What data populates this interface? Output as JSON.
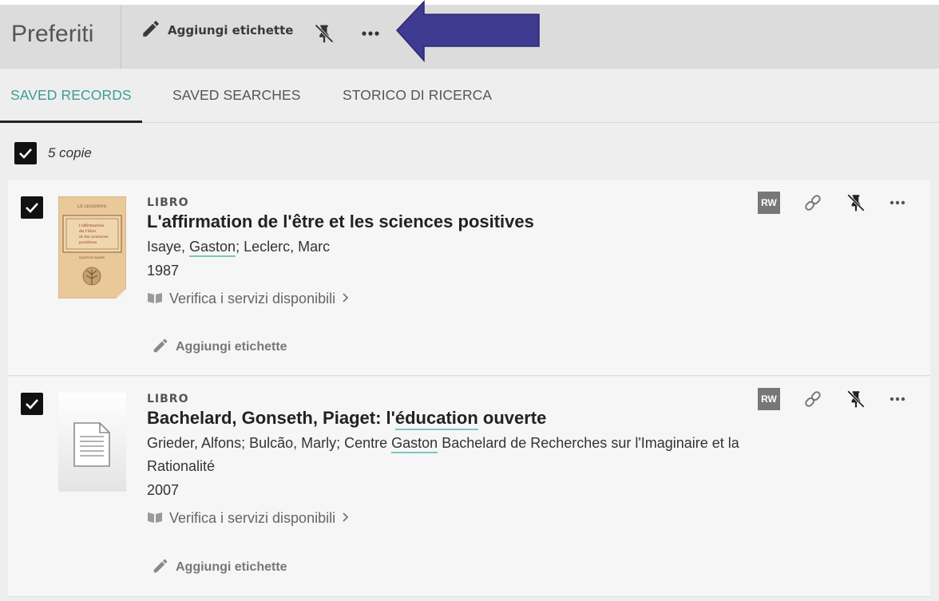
{
  "header": {
    "title": "Preferiti",
    "add_tags_label": "Aggiungi etichette"
  },
  "tabs": [
    {
      "label": "SAVED RECORDS",
      "active": true
    },
    {
      "label": "SAVED SEARCHES",
      "active": false
    },
    {
      "label": "STORICO DI RICERCA",
      "active": false
    }
  ],
  "selection": {
    "count_label": "5 copie",
    "checked": true
  },
  "records": [
    {
      "type": "LIBRO",
      "title": "L'affirmation de l'être et les sciences positives",
      "authors_pre": "Isaye, ",
      "authors_hl": "Gaston",
      "authors_post": "; Leclerc, Marc",
      "year": "1987",
      "services": "Verifica i servizi disponibili",
      "add_tags": "Aggiungi etichette",
      "rw_badge": "RW",
      "cover_text_top": "LE LESSIWVS",
      "cover_text_title": "L'affirmation de l'être et les sciences positives",
      "cover_text_author": "GASTON ISAYE"
    },
    {
      "type": "LIBRO",
      "title_pre": "Bachelard, Gonseth, Piaget: l'",
      "title_hl": "éducation",
      "title_post": " ouverte",
      "authors_pre": "Grieder, Alfons; Bulcão, Marly; Centre ",
      "authors_hl": "Gaston",
      "authors_post": " Bachelard de Recherches sur l'Imaginaire et la",
      "authors_line2": "Rationalité",
      "year": "2007",
      "services": "Verifica i servizi disponibili",
      "add_tags": "Aggiungi etichette",
      "rw_badge": "RW"
    }
  ],
  "colors": {
    "accent": "#3b9e93",
    "arrow": "#3f3b91"
  }
}
